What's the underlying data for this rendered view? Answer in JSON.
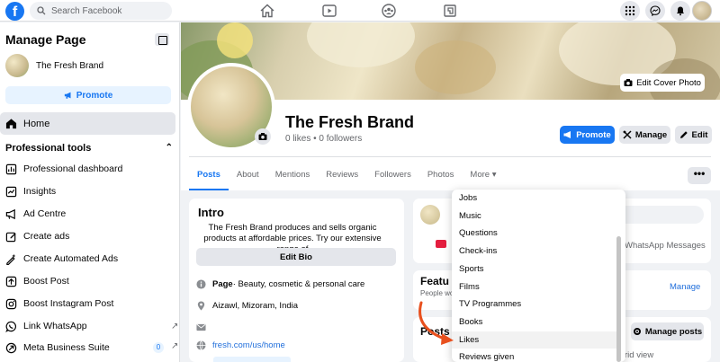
{
  "topbar": {
    "logo": "f",
    "search_placeholder": "Search Facebook",
    "nav_icons": [
      "home-icon",
      "video-icon",
      "groups-icon",
      "gaming-icon"
    ],
    "right_icons": [
      "menu-grid-icon",
      "messenger-icon",
      "bell-icon"
    ]
  },
  "sidebar": {
    "title": "Manage Page",
    "brand_name": "The Fresh Brand",
    "promote_label": "Promote",
    "home_label": "Home",
    "section_label": "Professional tools",
    "items": [
      {
        "label": "Professional dashboard",
        "icon": "dashboard-icon"
      },
      {
        "label": "Insights",
        "icon": "insights-icon"
      },
      {
        "label": "Ad Centre",
        "icon": "megaphone-icon"
      },
      {
        "label": "Create ads",
        "icon": "edit-square-icon"
      },
      {
        "label": "Create Automated Ads",
        "icon": "sparkle-edit-icon"
      },
      {
        "label": "Boost Post",
        "icon": "boost-icon"
      },
      {
        "label": "Boost Instagram Post",
        "icon": "instagram-icon"
      },
      {
        "label": "Link WhatsApp",
        "icon": "whatsapp-icon"
      },
      {
        "label": "Meta Business Suite",
        "icon": "meta-icon",
        "badge": "0"
      }
    ]
  },
  "header": {
    "edit_cover_label": "Edit Cover Photo",
    "page_name": "The Fresh Brand",
    "stats": "0 likes • 0 followers",
    "promote_label": "Promote",
    "manage_label": "Manage",
    "edit_label": "Edit",
    "tabs": [
      "Posts",
      "About",
      "Mentions",
      "Reviews",
      "Followers",
      "Photos",
      "More ▾"
    ],
    "more_button": "•••"
  },
  "intro": {
    "title": "Intro",
    "bio": "The Fresh Brand produces and sells organic products at affordable prices. Try our extensive range of",
    "edit_bio_label": "Edit Bio",
    "category_label": "Page",
    "category": " · Beauty, cosmetic & personal care",
    "location": "Aizawl, Mizoram, India",
    "website": "fresh.com/us/home"
  },
  "feed": {
    "whatsapp_text": "WhatsApp Messages",
    "featured_title": "Featu",
    "featured_sub": "People wo",
    "manage_link": "Manage",
    "posts_title": "Posts",
    "manage_posts_label": "Manage posts",
    "grid_view": "rid view"
  },
  "dropdown": {
    "items": [
      "Jobs",
      "Music",
      "Questions",
      "Check-ins",
      "Sports",
      "Films",
      "TV Programmes",
      "Books",
      "Likes",
      "Reviews given"
    ],
    "hovered_index": 8
  },
  "colors": {
    "accent": "#1877f2",
    "annotation_arrow": "#e8501e"
  }
}
